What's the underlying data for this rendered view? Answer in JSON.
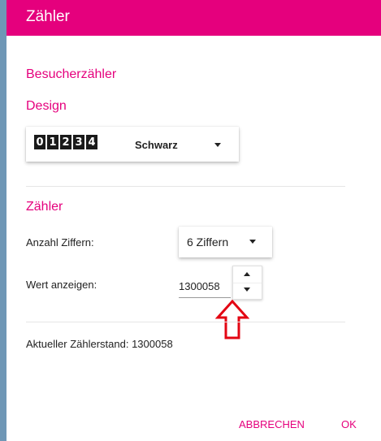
{
  "dialog": {
    "title": "Zähler",
    "subtitle": "Besucherzähler",
    "design": {
      "heading": "Design",
      "preview_digits": [
        "0",
        "1",
        "2",
        "3",
        "4"
      ],
      "selected": "Schwarz"
    },
    "counter": {
      "heading": "Zähler",
      "digits_label": "Anzahl Ziffern:",
      "digits_selected": "6 Ziffern",
      "value_label": "Wert anzeigen:",
      "value": "1300058"
    },
    "status_text": "Aktueller Zählerstand: 1300058",
    "buttons": {
      "cancel": "ABBRECHEN",
      "ok": "OK"
    }
  },
  "colors": {
    "accent": "#e5007d",
    "annotation_arrow": "#e30613",
    "background": "#6f97b6"
  }
}
